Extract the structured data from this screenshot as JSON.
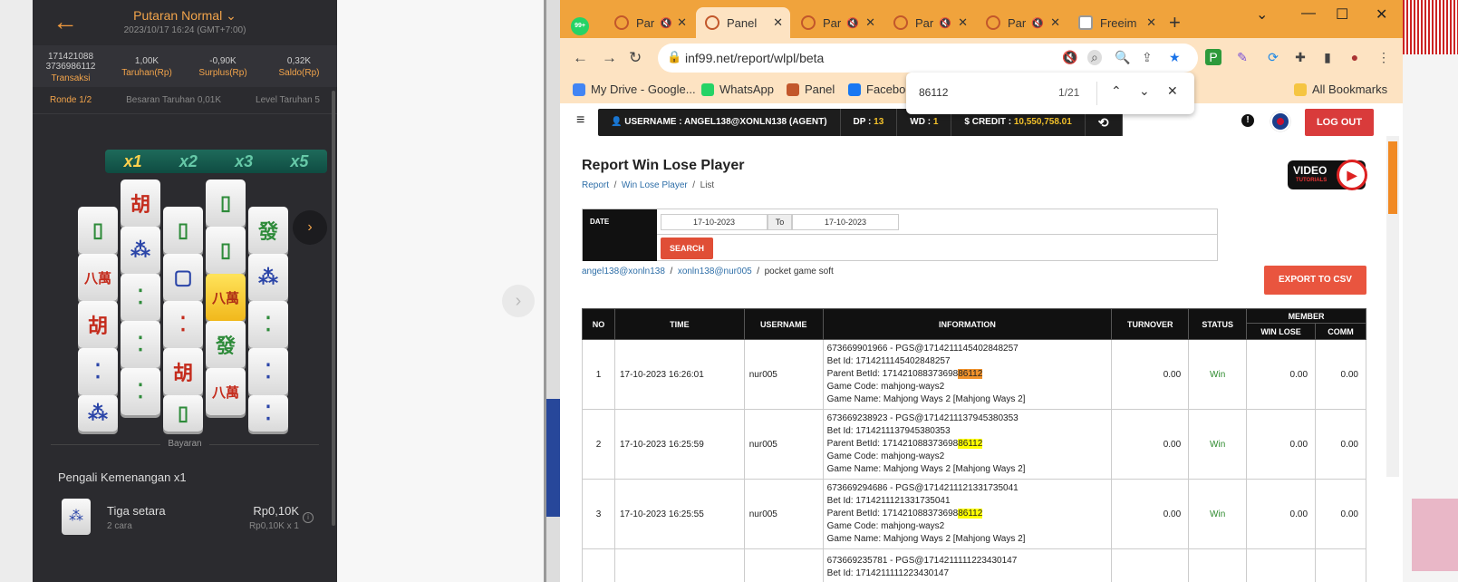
{
  "phone": {
    "title": "Putaran Normal",
    "chevron": "⌄",
    "subtitle": "2023/10/17 16:24 (GMT+7:00)",
    "stats": [
      {
        "value": "171421088\n3736986112",
        "label": "Transaksi"
      },
      {
        "value": "1,00K",
        "label": "Taruhan(Rp)"
      },
      {
        "value": "-0,90K",
        "label": "Surplus(Rp)"
      },
      {
        "value": "0,32K",
        "label": "Saldo(Rp)"
      }
    ],
    "round": "Ronde 1/2",
    "bet_size": "Besaran Taruhan 0,01K",
    "bet_level": "Level Taruhan 5",
    "multipliers": [
      "x1",
      "x2",
      "x3",
      "x5"
    ],
    "tiles": [
      {
        "glyph": "▯",
        "kind": "green"
      },
      {
        "glyph": "胡",
        "kind": "red"
      },
      {
        "glyph": "▯",
        "kind": "green"
      },
      {
        "glyph": "▯",
        "kind": "green"
      },
      {
        "glyph": "發",
        "kind": "green"
      },
      {
        "glyph": "八萬",
        "kind": "red"
      },
      {
        "glyph": "⁂",
        "kind": "blue"
      },
      {
        "glyph": "▢",
        "kind": "blue"
      },
      {
        "glyph": "▯",
        "kind": "green"
      },
      {
        "glyph": "⁂",
        "kind": "blue"
      },
      {
        "glyph": "胡",
        "kind": "red"
      },
      {
        "glyph": "⁚",
        "kind": "green"
      },
      {
        "glyph": "⁚",
        "kind": "red"
      },
      {
        "glyph": "八萬",
        "kind": "gold"
      },
      {
        "glyph": "⁚",
        "kind": "green"
      },
      {
        "glyph": "⁚",
        "kind": "blue"
      },
      {
        "glyph": "⁚",
        "kind": "green"
      },
      {
        "glyph": "胡",
        "kind": "red"
      },
      {
        "glyph": "發",
        "kind": "green"
      },
      {
        "glyph": "⁚",
        "kind": "blue"
      },
      {
        "glyph": "⁂",
        "kind": "blue"
      },
      {
        "glyph": "⁚",
        "kind": "green"
      },
      {
        "glyph": "▯",
        "kind": "green"
      },
      {
        "glyph": "八萬",
        "kind": "red"
      },
      {
        "glyph": "⁚",
        "kind": "blue"
      }
    ],
    "payout_header": "Bayaran",
    "multiplier_label": "Pengali Kemenangan x1",
    "win_name": "Tiga setara",
    "win_ways": "2 cara",
    "win_amount": "Rp0,10K",
    "win_formula": "Rp0,10K x 1"
  },
  "browser": {
    "tabs": [
      {
        "label": "Par",
        "muted": true,
        "icon": "panel"
      },
      {
        "label": "Panel",
        "muted": false,
        "icon": "panel",
        "active": true
      },
      {
        "label": "Par",
        "muted": true,
        "icon": "panel"
      },
      {
        "label": "Par",
        "muted": true,
        "icon": "panel"
      },
      {
        "label": "Par",
        "muted": true,
        "icon": "panel"
      },
      {
        "label": "Freeim",
        "muted": false,
        "icon": "freeim"
      }
    ],
    "whatsapp_badge": "99+",
    "url": "inf99.net/report/wlpl/beta",
    "bookmarks": [
      {
        "label": "My Drive - Google...",
        "color": "#4285f4"
      },
      {
        "label": "WhatsApp",
        "color": "#25d366"
      },
      {
        "label": "Panel",
        "color": "#c2572b"
      },
      {
        "label": "Facebook",
        "color": "#1877f2"
      }
    ],
    "all_bookmarks": "All Bookmarks",
    "find": {
      "query": "86112",
      "count": "1/21"
    }
  },
  "page": {
    "username": "USERNAME : ANGEL138@XONLN138 (AGENT)",
    "dp_label": "DP : ",
    "dp_value": "13",
    "wd_label": "WD : ",
    "wd_value": "1",
    "credit_label": "$ CREDIT : ",
    "credit_value": "10,550,758.01",
    "logout": "LOG OUT",
    "title": "Report Win Lose Player",
    "crumbs": [
      "Report",
      "Win Lose Player",
      "List"
    ],
    "video_label": "VIDEO",
    "video_sub": "TUTORIALS",
    "date_label": "DATE",
    "date_from": "17-10-2023",
    "to_label": "To",
    "date_to": "17-10-2023",
    "search": "SEARCH",
    "path": [
      "angel138@xonln138",
      "xonln138@nur005",
      "pocket game soft"
    ],
    "export": "EXPORT TO CSV",
    "columns": {
      "no": "NO",
      "time": "TIME",
      "username": "USERNAME",
      "information": "INFORMATION",
      "turnover": "TURNOVER",
      "status": "STATUS",
      "member": "MEMBER",
      "winlose": "WIN LOSE",
      "comm": "COMM"
    },
    "rows": [
      {
        "no": "1",
        "time": "17-10-2023 16:26:01",
        "username": "nur005",
        "info1": "673669901966 - PGS@1714211145402848257",
        "betid": "Bet Id: 1714211145402848257",
        "parent_pre": "Parent BetId: 171421088373698",
        "parent_hl": "86112",
        "code": "Game Code: mahjong-ways2",
        "name": "Game Name: Mahjong Ways 2 [Mahjong Ways 2]",
        "turnover": "0.00",
        "status": "Win",
        "winlose": "0.00",
        "comm": "0.00"
      },
      {
        "no": "2",
        "time": "17-10-2023 16:25:59",
        "username": "nur005",
        "info1": "673669238923 - PGS@1714211137945380353",
        "betid": "Bet Id: 1714211137945380353",
        "parent_pre": "Parent BetId: 171421088373698",
        "parent_hl": "86112",
        "code": "Game Code: mahjong-ways2",
        "name": "Game Name: Mahjong Ways 2 [Mahjong Ways 2]",
        "turnover": "0.00",
        "status": "Win",
        "winlose": "0.00",
        "comm": "0.00"
      },
      {
        "no": "3",
        "time": "17-10-2023 16:25:55",
        "username": "nur005",
        "info1": "673669294686 - PGS@1714211121331735041",
        "betid": "Bet Id: 1714211121331735041",
        "parent_pre": "Parent BetId: 171421088373698",
        "parent_hl": "86112",
        "code": "Game Code: mahjong-ways2",
        "name": "Game Name: Mahjong Ways 2 [Mahjong Ways 2]",
        "turnover": "0.00",
        "status": "Win",
        "winlose": "0.00",
        "comm": "0.00"
      },
      {
        "no": "",
        "time": "",
        "username": "",
        "info1": "673669235781 - PGS@1714211111223430147",
        "betid": "Bet Id: 1714211111223430147",
        "parent_pre": "",
        "parent_hl": "",
        "code": "",
        "name": "",
        "turnover": "",
        "status": "",
        "winlose": "",
        "comm": ""
      }
    ]
  }
}
